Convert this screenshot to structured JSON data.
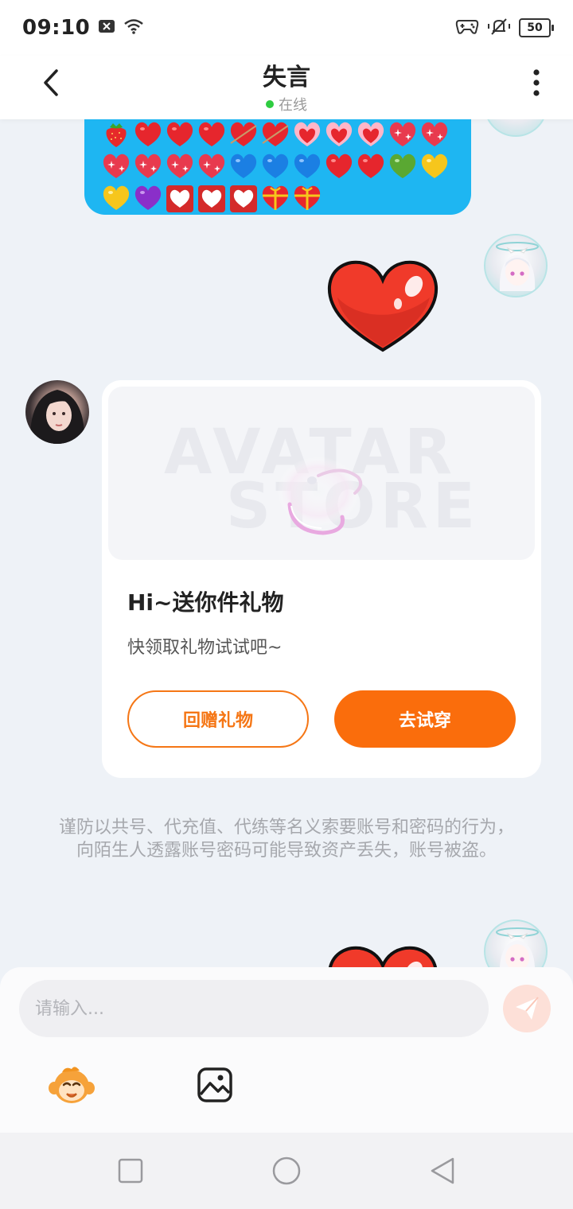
{
  "status_bar": {
    "time": "09:10",
    "battery": "50"
  },
  "header": {
    "title": "失言",
    "status": "在线"
  },
  "gift_card": {
    "image_watermark_top": "AVATAR",
    "image_watermark_bottom": "STORE",
    "title": "Hi~送你件礼物",
    "subtitle": "快领取礼物试试吧~",
    "return_gift_label": "回赠礼物",
    "try_on_label": "去试穿"
  },
  "warning": {
    "text": "谨防以共号、代充值、代练等名义索要账号和密码的行为，向陌生人透露账号密码可能导致资产丢失，账号被盗。"
  },
  "input": {
    "placeholder": "请输入..."
  },
  "emoji_message": {
    "rows": [
      [
        "strawberry",
        "heart",
        "heart",
        "heart",
        "heart-arrow",
        "heart-arrow",
        "heart-ribbon",
        "heart-ribbon",
        "heart-ribbon",
        "sparkle-heart",
        "sparkle-heart"
      ],
      [
        "sparkle-heart",
        "sparkle-heart",
        "sparkle-heart",
        "sparkle-heart",
        "blue-heart",
        "blue-heart",
        "blue-heart",
        "heart",
        "heart",
        "green-heart",
        "yellow-heart"
      ],
      [
        "yellow-heart",
        "purple-heart",
        "white-heart-box",
        "white-heart-box",
        "white-heart-box",
        "gift-heart",
        "gift-heart"
      ]
    ]
  },
  "colors": {
    "accent_orange": "#fa6d0c",
    "bubble_blue": "#1eb6f2",
    "online_green": "#2ecc40",
    "heart_red": "#f03a2a"
  },
  "icons": {
    "back": "chevron-left-icon",
    "more": "more-vertical-icon",
    "send": "paper-plane-icon",
    "sticker": "monkey-face-icon",
    "image": "image-icon"
  }
}
